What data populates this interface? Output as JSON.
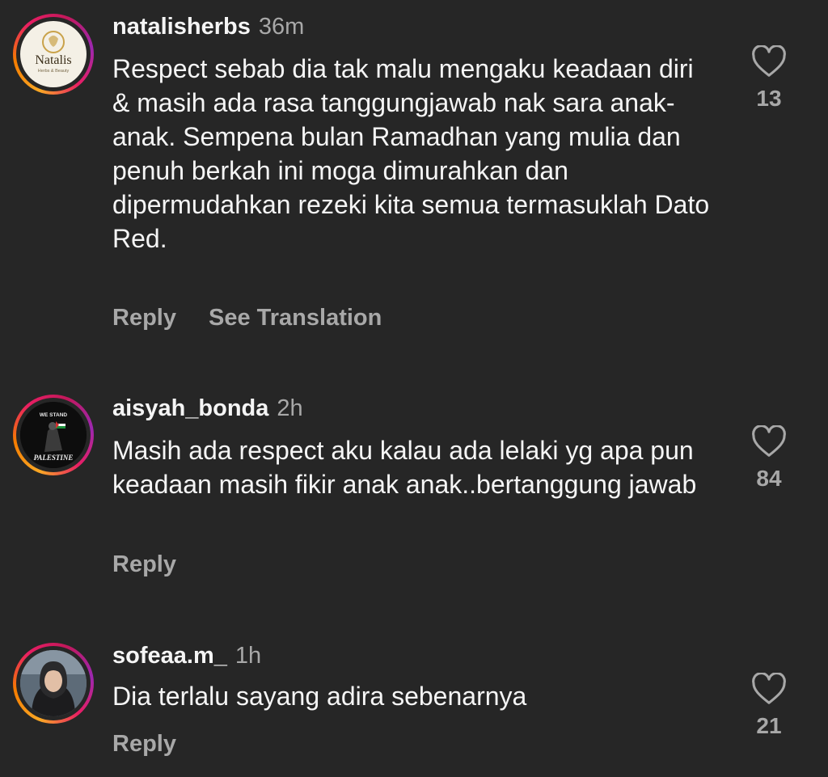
{
  "comments": [
    {
      "username": "natalisherbs",
      "time": "36m",
      "text": "Respect sebab dia tak malu mengaku keadaan diri & masih ada rasa tanggungjawab nak sara anak-anak. Sempena bulan Ramadhan yang mulia dan penuh berkah ini moga dimurahkan dan dipermudahkan rezeki kita semua termasuklah Dato Red.",
      "reply_label": "Reply",
      "translate_label": "See Translation",
      "likes": "13",
      "avatar": {
        "brand": "Natalis",
        "tagline": "Herbs & Beauty"
      }
    },
    {
      "username": "aisyah_bonda",
      "time": "2h",
      "text": "Masih ada respect aku kalau ada lelaki yg apa pun keadaan masih fikir anak anak..bertanggung jawab",
      "reply_label": "Reply",
      "likes": "84",
      "avatar": {
        "top": "WE STAND",
        "bottom": "PALESTINE"
      }
    },
    {
      "username": "sofeaa.m_",
      "time": "1h",
      "text": "Dia terlalu sayang adira sebenarnya",
      "reply_label": "Reply",
      "likes": "21"
    }
  ],
  "icons": {
    "like": "heart-outline-icon"
  },
  "colors": {
    "background": "#262626",
    "text": "#f5f5f5",
    "secondary": "#a8a8a8"
  }
}
